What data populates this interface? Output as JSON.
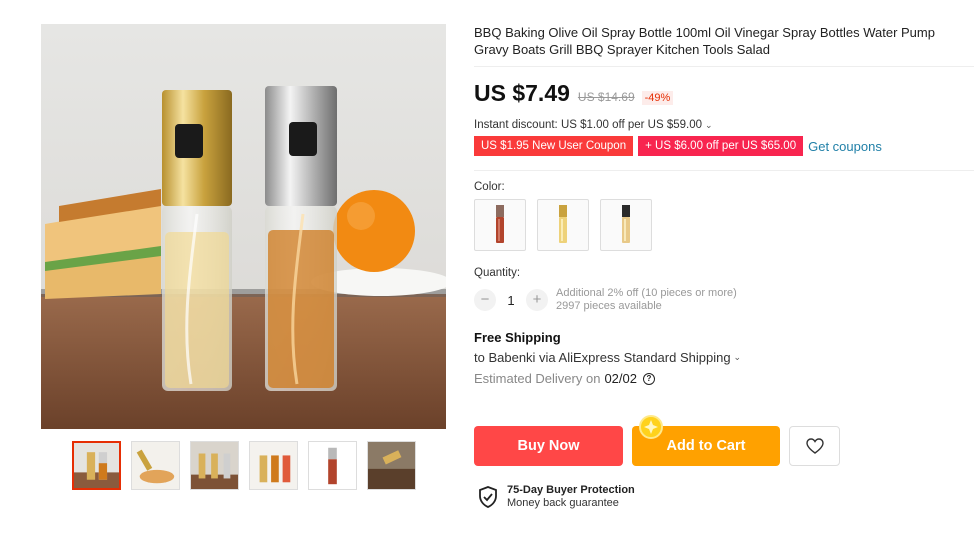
{
  "product": {
    "title": "BBQ Baking Olive Oil Spray Bottle 100ml Oil Vinegar Spray Bottles Water Pump Gravy Boats Grill BBQ Sprayer Kitchen Tools Salad",
    "price": "US $7.49",
    "original_price": "US $14.69",
    "discount": "-49%"
  },
  "promo": {
    "instant_discount": "Instant discount: US $1.00 off per US $59.00",
    "coupons": [
      "US $1.95 New User Coupon",
      "+ US $6.00 off per US $65.00"
    ],
    "get_coupons": "Get coupons"
  },
  "options": {
    "color_label": "Color:",
    "swatches": [
      "red-bottle",
      "gold-bottle",
      "black-bottle"
    ]
  },
  "quantity": {
    "label": "Quantity:",
    "value": "1",
    "minus": "−",
    "plus": "+",
    "note1": "Additional 2% off (10 pieces or more)",
    "note2": "2997 pieces available"
  },
  "shipping": {
    "title": "Free Shipping",
    "line": "to Babenki via AliExpress Standard Shipping",
    "est_label": "Estimated Delivery on",
    "date": "02/02"
  },
  "actions": {
    "buy_now": "Buy Now",
    "add_to_cart": "Add to Cart"
  },
  "protection": {
    "title": "75-Day Buyer Protection",
    "subtitle": "Money back guarantee"
  },
  "colors": {
    "accent_red": "#ff4747",
    "accent_orange": "#ffa100",
    "link": "#2180a8"
  }
}
